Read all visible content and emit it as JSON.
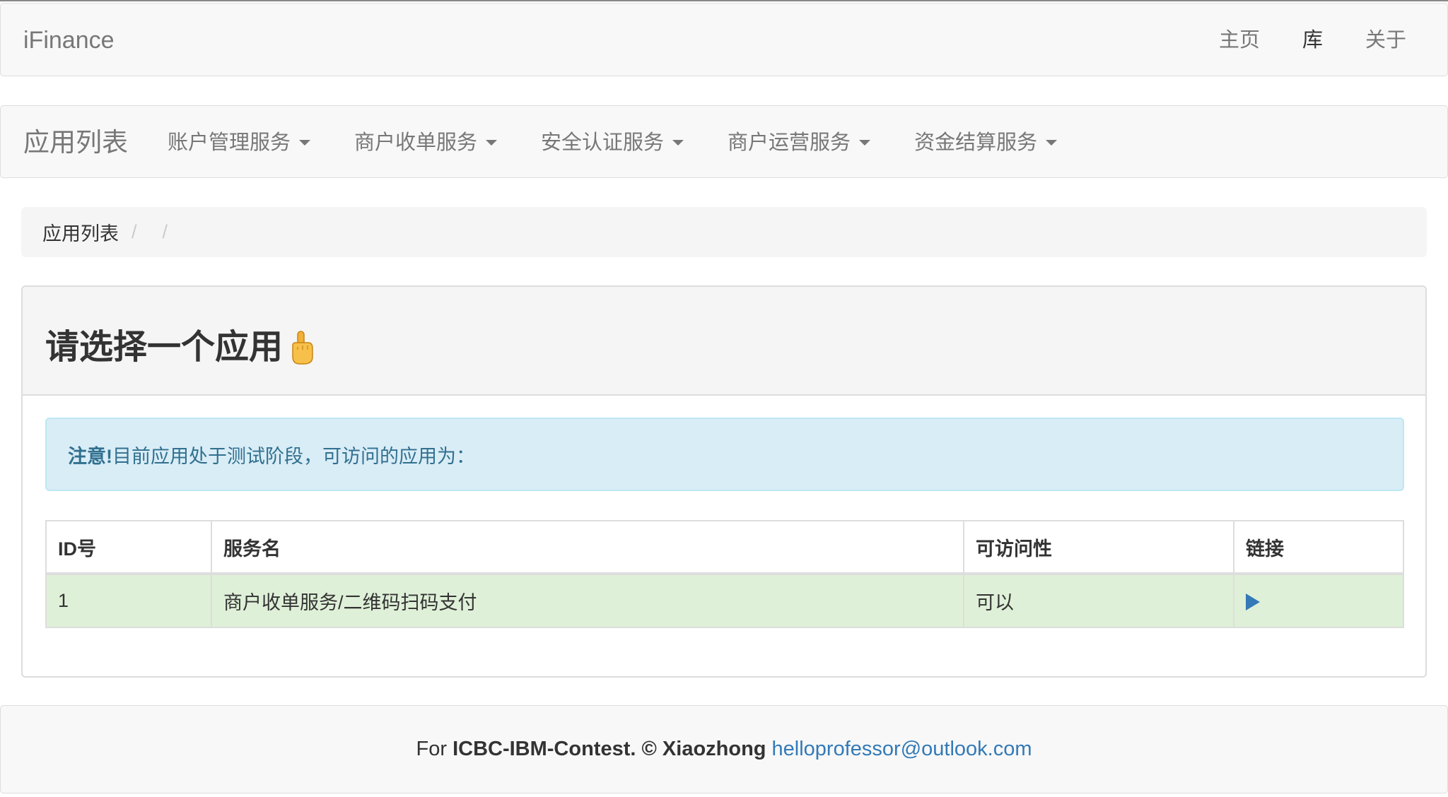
{
  "app": {
    "brand": "iFinance"
  },
  "top_nav": {
    "links": [
      "主页",
      "库",
      "关于"
    ],
    "active_index": 1
  },
  "app_nav": {
    "title": "应用列表",
    "menus": [
      "账户管理服务",
      "商户收单服务",
      "安全认证服务",
      "商户运营服务",
      "资金结算服务"
    ]
  },
  "breadcrumb": {
    "items": [
      "应用列表",
      "",
      ""
    ],
    "separator": "/"
  },
  "panel": {
    "title": "请选择一个应用",
    "alert": {
      "strong": "注意!",
      "text": "目前应用处于测试阶段，可访问的应用为："
    },
    "table": {
      "headers": [
        "ID号",
        "服务名",
        "可访问性",
        "链接"
      ],
      "rows": [
        {
          "id": "1",
          "service": "商户收单服务/二维码扫码支付",
          "access": "可以",
          "link_icon": "play-icon"
        }
      ]
    }
  },
  "footer": {
    "prefix": "For",
    "contest": "ICBC-IBM-Contest.",
    "copyright": "© Xiaozhong",
    "email": "helloprofessor@outlook.com"
  },
  "colors": {
    "link_blue": "#337ab7",
    "alert_bg": "#d9edf7",
    "alert_text": "#31708f",
    "success_row": "#dff0d8"
  }
}
